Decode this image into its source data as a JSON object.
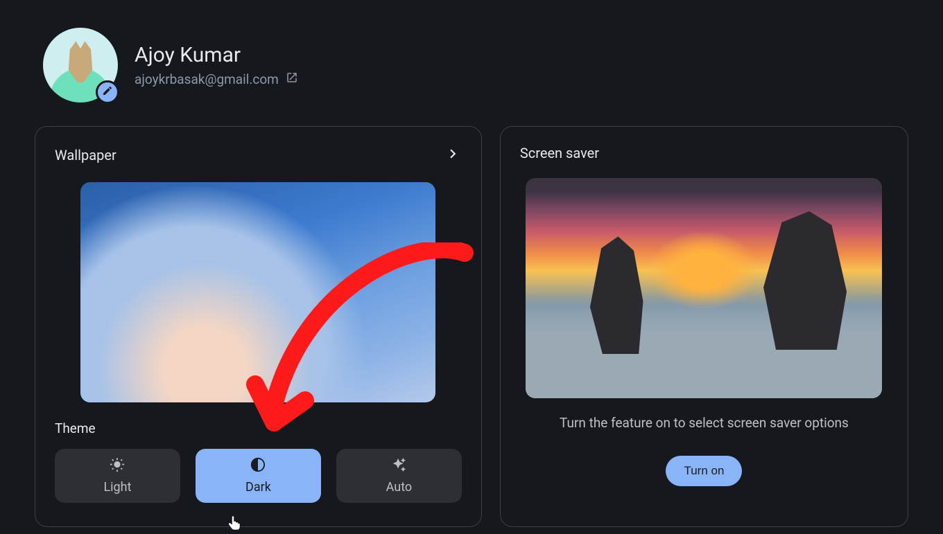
{
  "profile": {
    "name": "Ajoy Kumar",
    "email": "ajoykrbasak@gmail.com"
  },
  "wallpaper": {
    "title": "Wallpaper",
    "theme_label": "Theme",
    "themes": {
      "light": "Light",
      "dark": "Dark",
      "auto": "Auto"
    },
    "selected_theme": "dark"
  },
  "screensaver": {
    "title": "Screen saver",
    "hint": "Turn the feature on to select screen saver options",
    "button": "Turn on"
  }
}
